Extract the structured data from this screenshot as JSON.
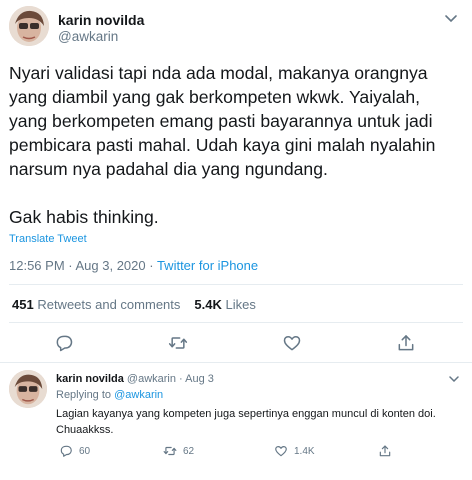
{
  "tweet": {
    "author_name": "karin novilda",
    "author_handle": "@awkarin",
    "text_p1": "Nyari validasi tapi nda ada modal, makanya orangnya\nyang diambil yang gak berkompeten wkwk. Yaiyalah,\nyang berkompeten emang pasti bayarannya untuk jadi\npembicara pasti mahal. Udah kaya gini malah nyalahin\nnarsum nya padahal dia yang ngundang.",
    "text_p2": "Gak habis thinking.",
    "translate_label": "Translate Tweet",
    "time": "12:56 PM",
    "separator": " · ",
    "date": "Aug 3, 2020",
    "source": "Twitter for iPhone",
    "retweets_count": "451",
    "retweets_label": "Retweets and comments",
    "likes_count": "5.4K",
    "likes_label": "Likes"
  },
  "reply": {
    "author_name": "karin novilda",
    "author_handle": "@awkarin",
    "separator": " · ",
    "date": "Aug 3",
    "replying_prefix": "Replying to ",
    "replying_to": "@awkarin",
    "text": "Lagian kayanya yang kompeten juga sepertinya enggan muncul di konten doi. Chuaakkss.",
    "reply_count": "60",
    "retweet_count": "62",
    "like_count": "1.4K"
  },
  "colors": {
    "link": "#1b95e0",
    "muted": "#657786",
    "text": "#14171a",
    "divider": "#e6ecf0"
  },
  "icons": [
    "reply-icon",
    "retweet-icon",
    "like-icon",
    "share-icon",
    "caret-down-icon"
  ]
}
